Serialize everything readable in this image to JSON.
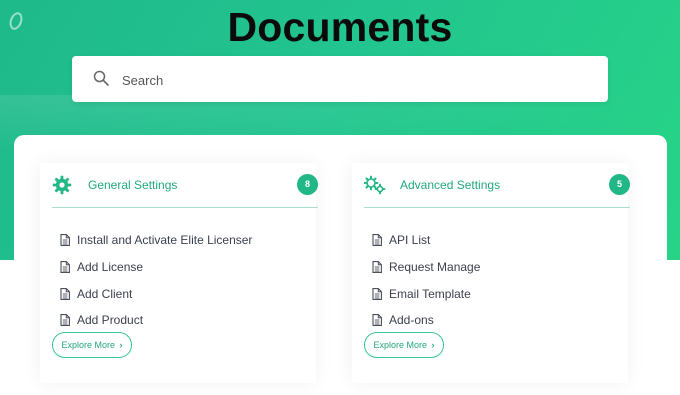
{
  "page": {
    "title": "Documents"
  },
  "search": {
    "placeholder": "Search"
  },
  "categories": [
    {
      "title": "General Settings",
      "count": "8",
      "docs": [
        "Install and Activate Elite Licenser",
        "Add License",
        "Add Client",
        "Add Product"
      ],
      "explore_label": "Explore More",
      "icon": "gear-icon"
    },
    {
      "title": "Advanced Settings",
      "count": "5",
      "docs": [
        "API List",
        "Request Manage",
        "Email Template",
        "Add-ons"
      ],
      "explore_label": "Explore More",
      "icon": "gears-icon"
    }
  ],
  "colors": {
    "accent": "#22b786",
    "hero_start": "#1fb98a",
    "hero_end": "#27d487",
    "text": "#3c4050"
  }
}
